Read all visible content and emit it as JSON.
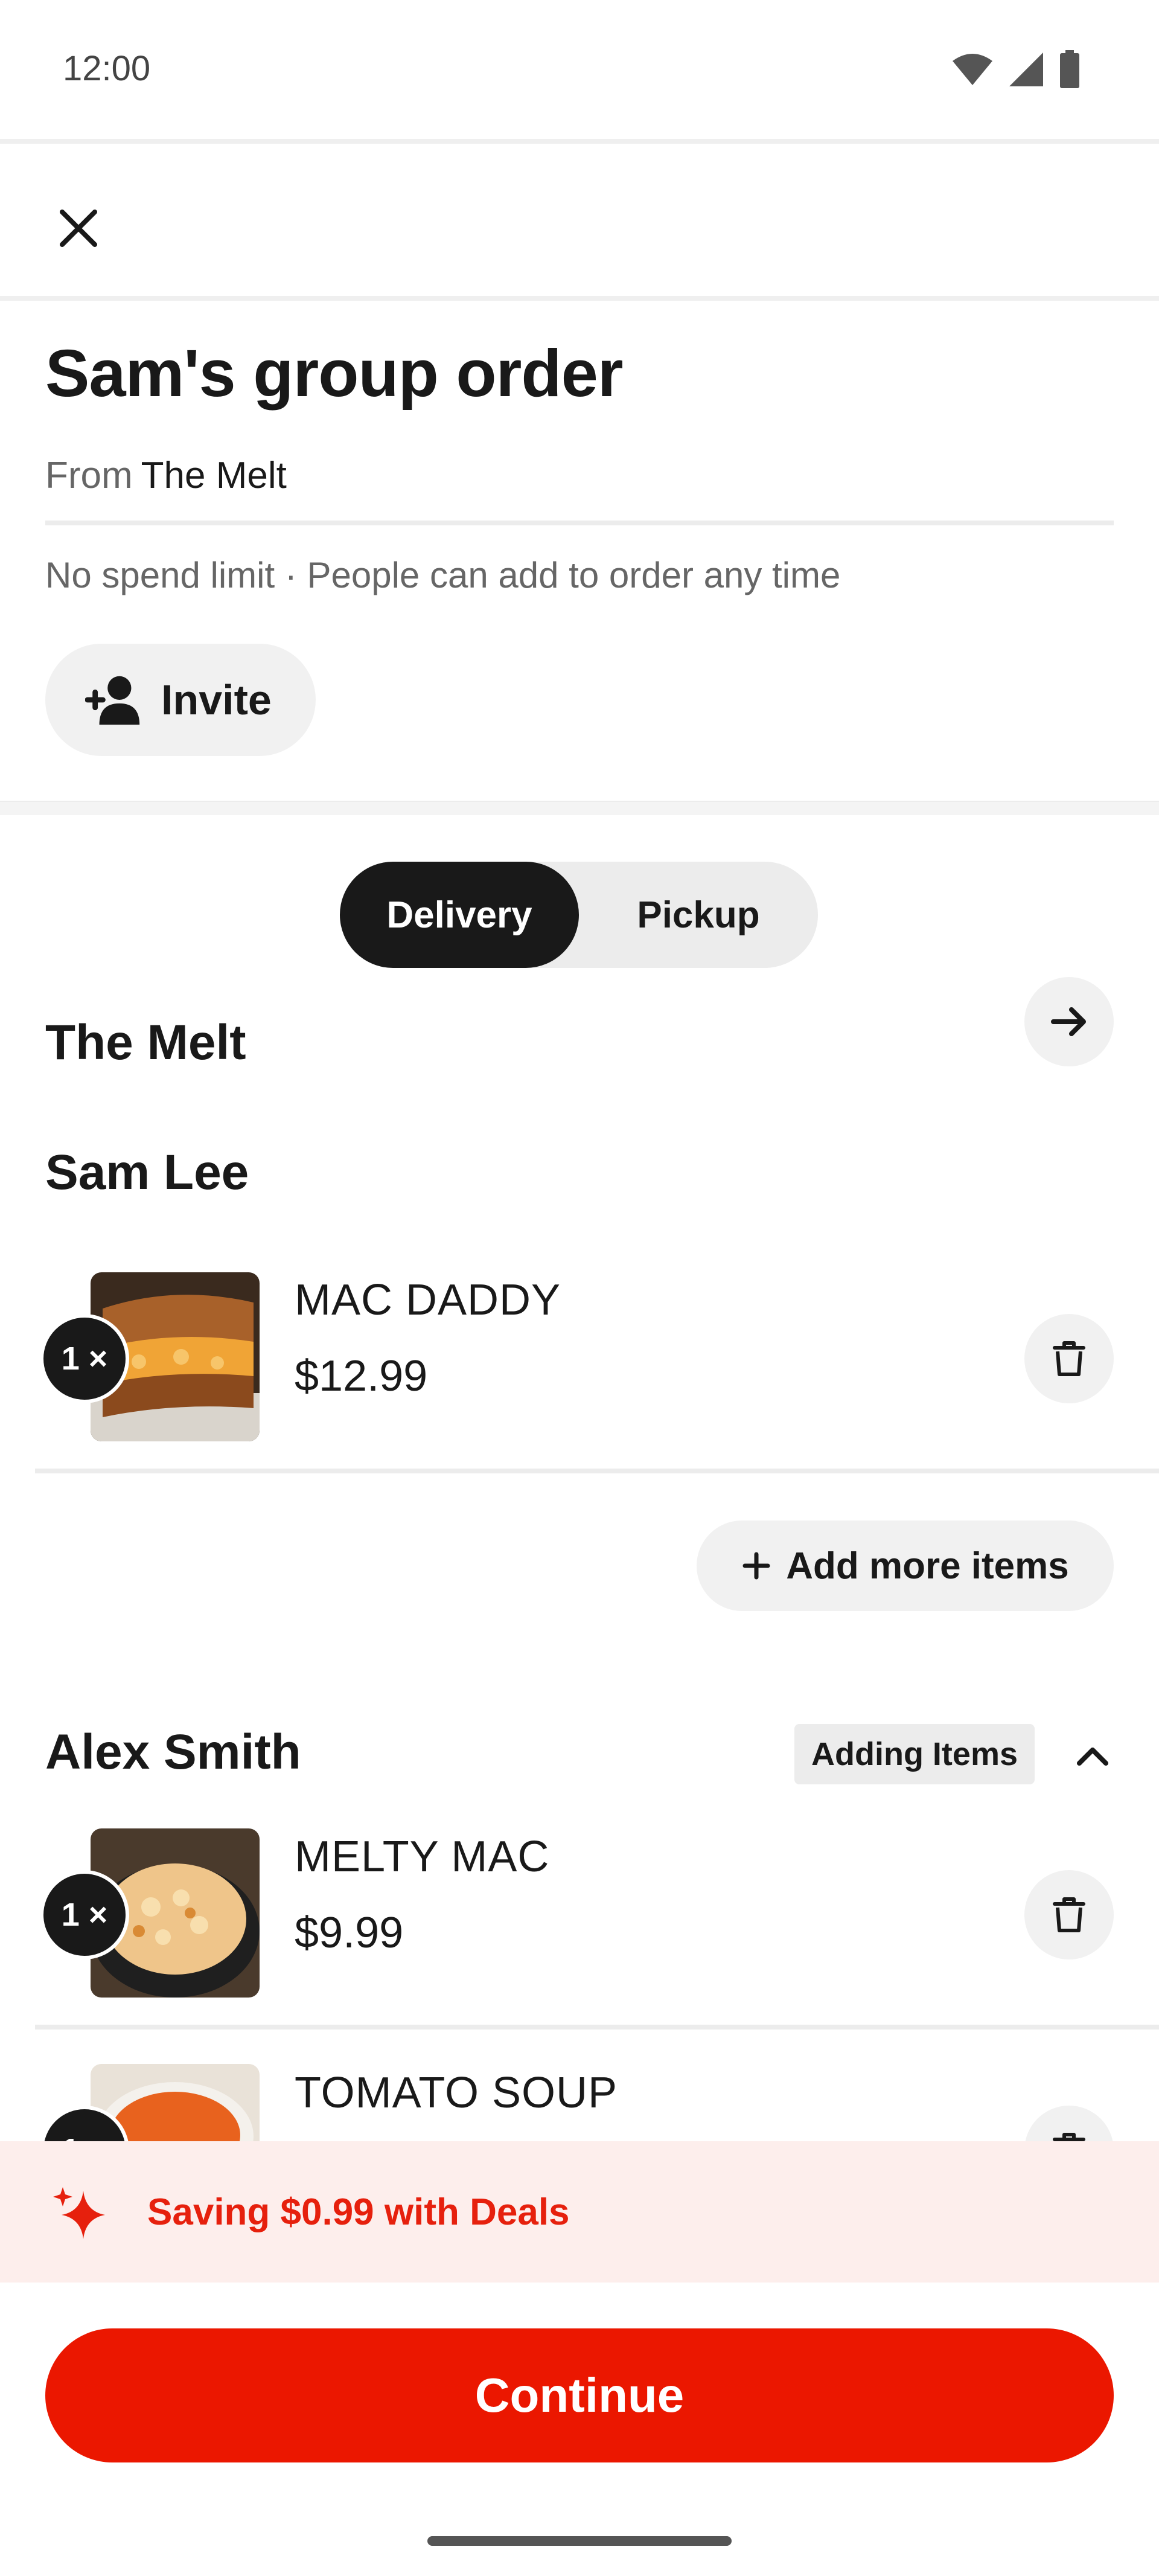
{
  "status_bar": {
    "time": "12:00"
  },
  "order": {
    "title": "Sam's group order",
    "from_label": "From",
    "store": "The Melt",
    "limit_text": "No spend limit · People can add to order any time",
    "invite_label": "Invite"
  },
  "fulfillment": {
    "options": [
      "Delivery",
      "Pickup"
    ],
    "selected": "Delivery"
  },
  "store_section": {
    "name": "The Melt"
  },
  "participants": [
    {
      "name": "Sam Lee",
      "items": [
        {
          "qty": "1 ×",
          "name": "MAC DADDY",
          "price": "$12.99"
        }
      ],
      "add_more_label": "Add more items"
    },
    {
      "name": "Alex Smith",
      "status": "Adding Items",
      "items": [
        {
          "qty": "1 ×",
          "name": "MELTY MAC",
          "price": "$9.99"
        },
        {
          "qty": "1 ×",
          "name": "TOMATO SOUP"
        }
      ]
    }
  ],
  "deals": {
    "text": "Saving $0.99 with Deals"
  },
  "continue_label": "Continue",
  "colors": {
    "accent": "#eb1700",
    "deals_bg": "#fdeeec",
    "dark": "#191919"
  },
  "icons": [
    "wifi-icon",
    "signal-icon",
    "battery-icon",
    "close-icon",
    "add-person-icon",
    "arrow-right-icon",
    "trash-icon",
    "plus-icon",
    "chevron-up-icon",
    "sparkle-icon"
  ]
}
